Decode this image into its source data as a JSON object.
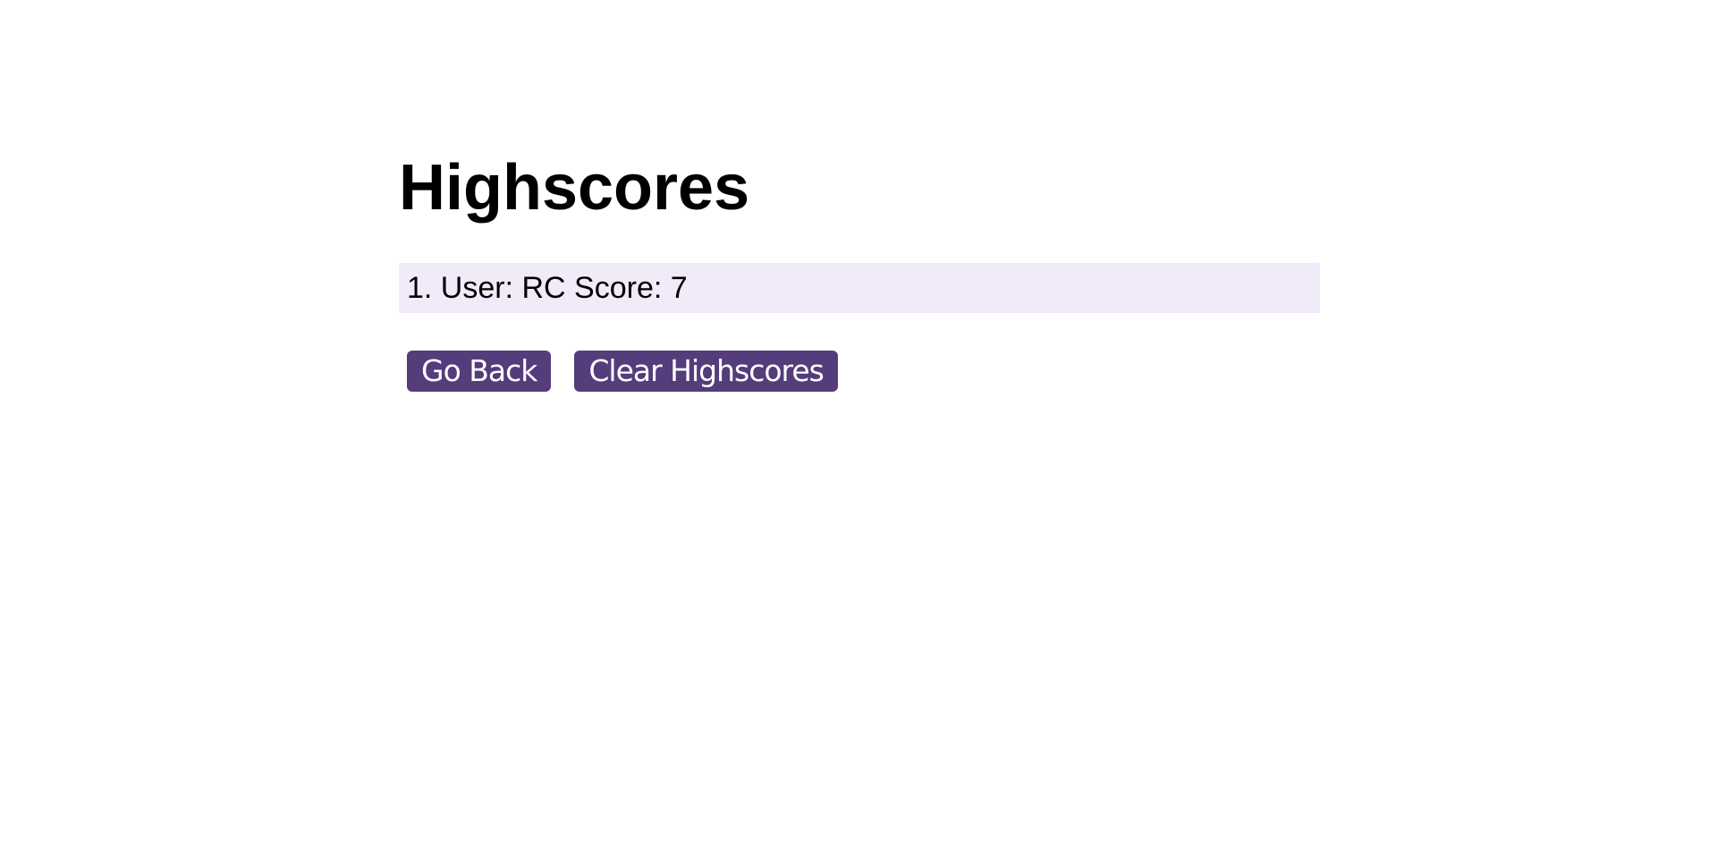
{
  "header": {
    "title": "Highscores"
  },
  "scores": [
    {
      "text": "1. User: RC Score: 7"
    }
  ],
  "actions": {
    "go_back_label": "Go Back",
    "clear_label": "Clear Highscores"
  },
  "colors": {
    "button_bg": "#553c7b",
    "button_text": "#ffffff",
    "score_row_bg": "#f1ebf9"
  }
}
